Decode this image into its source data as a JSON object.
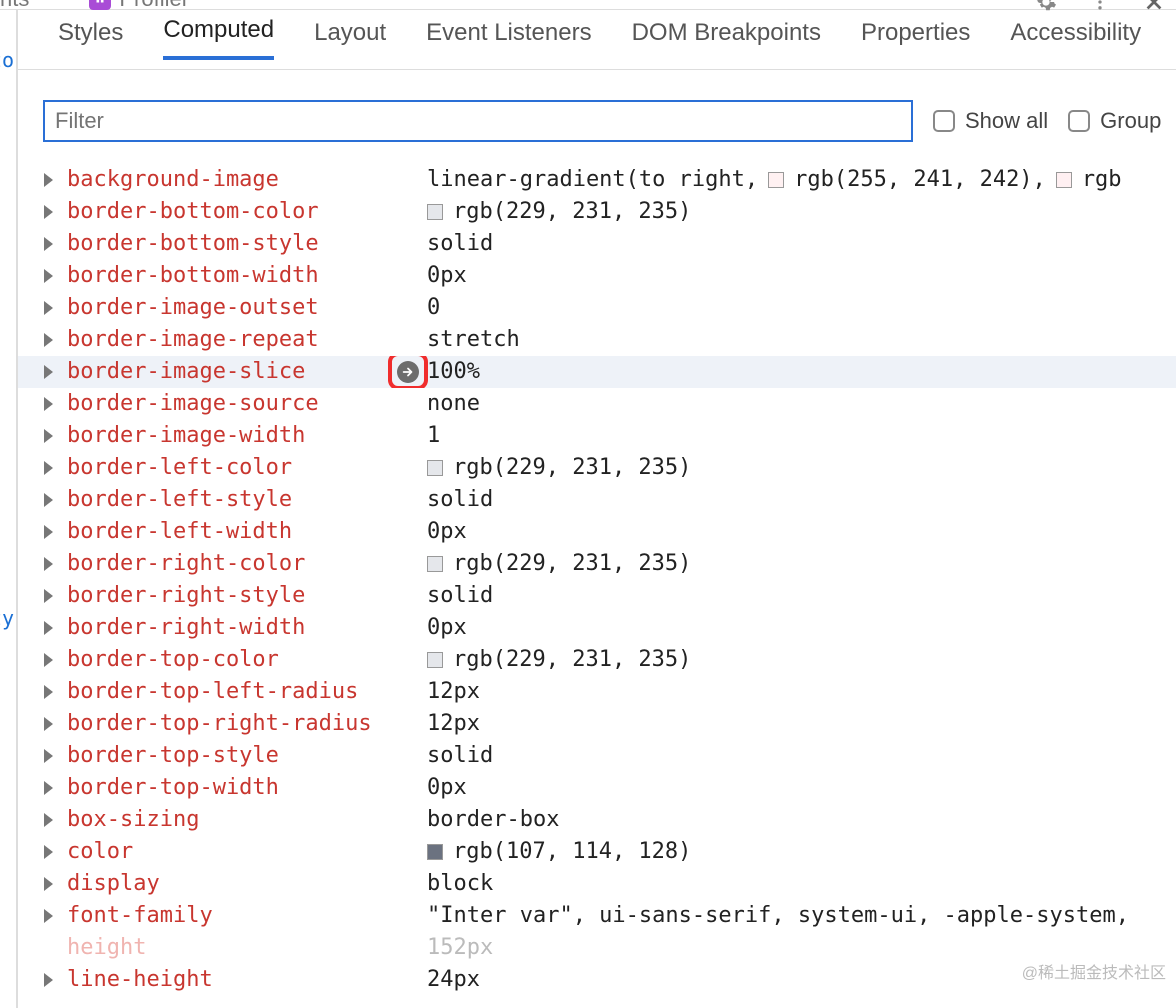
{
  "top": {
    "fragments": [
      "nts",
      "Profiler"
    ]
  },
  "tabs": [
    {
      "label": "Styles",
      "active": false
    },
    {
      "label": "Computed",
      "active": true
    },
    {
      "label": "Layout",
      "active": false
    },
    {
      "label": "Event Listeners",
      "active": false
    },
    {
      "label": "DOM Breakpoints",
      "active": false
    },
    {
      "label": "Properties",
      "active": false
    },
    {
      "label": "Accessibility",
      "active": false
    }
  ],
  "filter": {
    "placeholder": "Filter",
    "show_all_label": "Show all",
    "group_label": "Group"
  },
  "left_fragments": {
    "a": "to",
    "b": "ty"
  },
  "watermark": "@稀土掘金技术社区",
  "props": [
    {
      "name": "background-image",
      "value": "linear-gradient(to right, ",
      "swatches": [
        "#fff1f2"
      ],
      "tail": "rgb(255, 241, 242), ",
      "swatches2": [
        "#fff0f2"
      ],
      "tail2": "rgb"
    },
    {
      "name": "border-bottom-color",
      "value": "",
      "swatches": [
        "#e5e7eb"
      ],
      "tail": "rgb(229, 231, 235)"
    },
    {
      "name": "border-bottom-style",
      "value": "solid"
    },
    {
      "name": "border-bottom-width",
      "value": "0px"
    },
    {
      "name": "border-image-outset",
      "value": "0"
    },
    {
      "name": "border-image-repeat",
      "value": "stretch"
    },
    {
      "name": "border-image-slice",
      "value": "100%",
      "hovered": true,
      "goto": true,
      "red_ring": true
    },
    {
      "name": "border-image-source",
      "value": "none"
    },
    {
      "name": "border-image-width",
      "value": "1"
    },
    {
      "name": "border-left-color",
      "value": "",
      "swatches": [
        "#e5e7eb"
      ],
      "tail": "rgb(229, 231, 235)"
    },
    {
      "name": "border-left-style",
      "value": "solid"
    },
    {
      "name": "border-left-width",
      "value": "0px"
    },
    {
      "name": "border-right-color",
      "value": "",
      "swatches": [
        "#e5e7eb"
      ],
      "tail": "rgb(229, 231, 235)"
    },
    {
      "name": "border-right-style",
      "value": "solid"
    },
    {
      "name": "border-right-width",
      "value": "0px"
    },
    {
      "name": "border-top-color",
      "value": "",
      "swatches": [
        "#e5e7eb"
      ],
      "tail": "rgb(229, 231, 235)"
    },
    {
      "name": "border-top-left-radius",
      "value": "12px"
    },
    {
      "name": "border-top-right-radius",
      "value": "12px"
    },
    {
      "name": "border-top-style",
      "value": "solid"
    },
    {
      "name": "border-top-width",
      "value": "0px"
    },
    {
      "name": "box-sizing",
      "value": "border-box"
    },
    {
      "name": "color",
      "value": "",
      "swatches": [
        "#6b7280"
      ],
      "tail": "rgb(107, 114, 128)"
    },
    {
      "name": "display",
      "value": "block"
    },
    {
      "name": "font-family",
      "value": "\"Inter var\", ui-sans-serif, system-ui, -apple-system,"
    },
    {
      "name": "height",
      "value": "152px",
      "faded": true,
      "no_tri": true
    },
    {
      "name": "line-height",
      "value": "24px"
    }
  ]
}
